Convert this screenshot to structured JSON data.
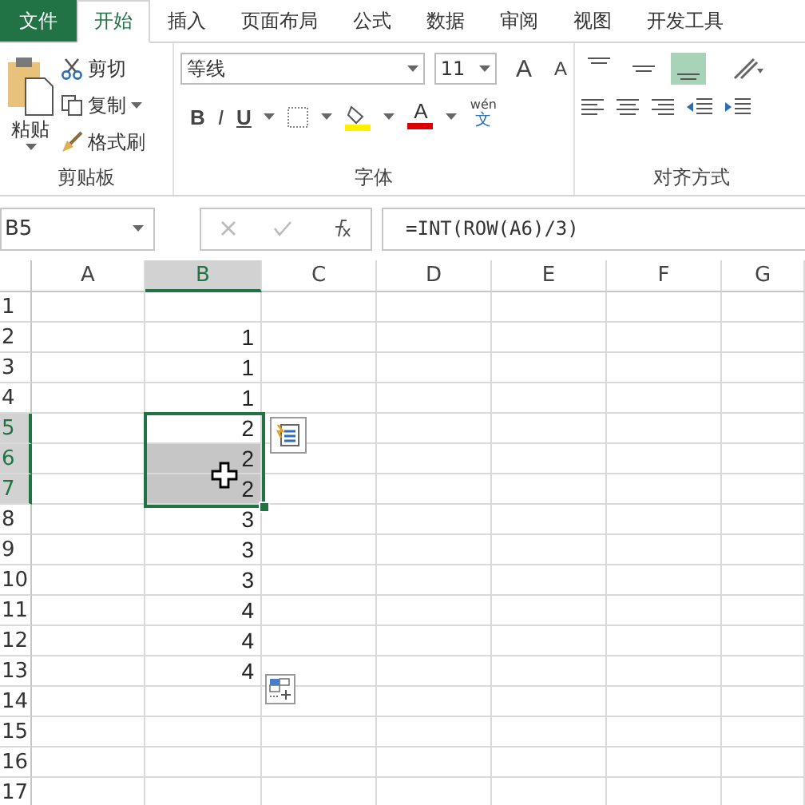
{
  "tabs": [
    {
      "label": "文件",
      "kind": "file",
      "selected": false
    },
    {
      "label": "开始",
      "kind": "tab",
      "selected": true
    },
    {
      "label": "插入",
      "kind": "tab",
      "selected": false
    },
    {
      "label": "页面布局",
      "kind": "tab",
      "selected": false
    },
    {
      "label": "公式",
      "kind": "tab",
      "selected": false
    },
    {
      "label": "数据",
      "kind": "tab",
      "selected": false
    },
    {
      "label": "审阅",
      "kind": "tab",
      "selected": false
    },
    {
      "label": "视图",
      "kind": "tab",
      "selected": false
    },
    {
      "label": "开发工具",
      "kind": "tab",
      "selected": false
    }
  ],
  "clipboard": {
    "paste": "粘贴",
    "cut": "剪切",
    "copy": "复制",
    "format_painter": "格式刷",
    "group_label": "剪贴板"
  },
  "font": {
    "font_name": "等线",
    "font_size": "11",
    "grow": "A",
    "shrink": "A",
    "bold": "B",
    "italic": "I",
    "underline": "U",
    "font_color": "A",
    "phonetic_top": "wén",
    "phonetic_bottom": "文",
    "group_label": "字体"
  },
  "alignment": {
    "vertical": [
      {
        "kind": "top",
        "selected": false
      },
      {
        "kind": "middle",
        "selected": false
      },
      {
        "kind": "bottom",
        "selected": true
      }
    ],
    "group_label": "对齐方式"
  },
  "formula_bar": {
    "name_box": "B5",
    "formula": "=INT(ROW(A6)/3)"
  },
  "columns": [
    {
      "label": "A",
      "selected": false
    },
    {
      "label": "B",
      "selected": true
    },
    {
      "label": "C",
      "selected": false
    },
    {
      "label": "D",
      "selected": false
    },
    {
      "label": "E",
      "selected": false
    },
    {
      "label": "F",
      "selected": false
    },
    {
      "label": "G",
      "selected": false
    }
  ],
  "rows": [
    {
      "label": "1",
      "selected": false
    },
    {
      "label": "2",
      "selected": false,
      "value": "1"
    },
    {
      "label": "3",
      "selected": false,
      "value": "1"
    },
    {
      "label": "4",
      "selected": false,
      "value": "1"
    },
    {
      "label": "5",
      "selected": true,
      "active": true,
      "value": "2"
    },
    {
      "label": "6",
      "selected": true,
      "active": false,
      "value": "2"
    },
    {
      "label": "7",
      "selected": true,
      "active": false,
      "value": "2"
    },
    {
      "label": "8",
      "selected": false,
      "value": "3"
    },
    {
      "label": "9",
      "selected": false,
      "value": "3"
    },
    {
      "label": "10",
      "selected": false,
      "value": "3"
    },
    {
      "label": "11",
      "selected": false,
      "value": "4"
    },
    {
      "label": "12",
      "selected": false,
      "value": "4"
    },
    {
      "label": "13",
      "selected": false,
      "value": "4"
    },
    {
      "label": "14",
      "selected": false
    },
    {
      "label": "15",
      "selected": false
    },
    {
      "label": "16",
      "selected": false
    },
    {
      "label": "17",
      "selected": false
    }
  ]
}
